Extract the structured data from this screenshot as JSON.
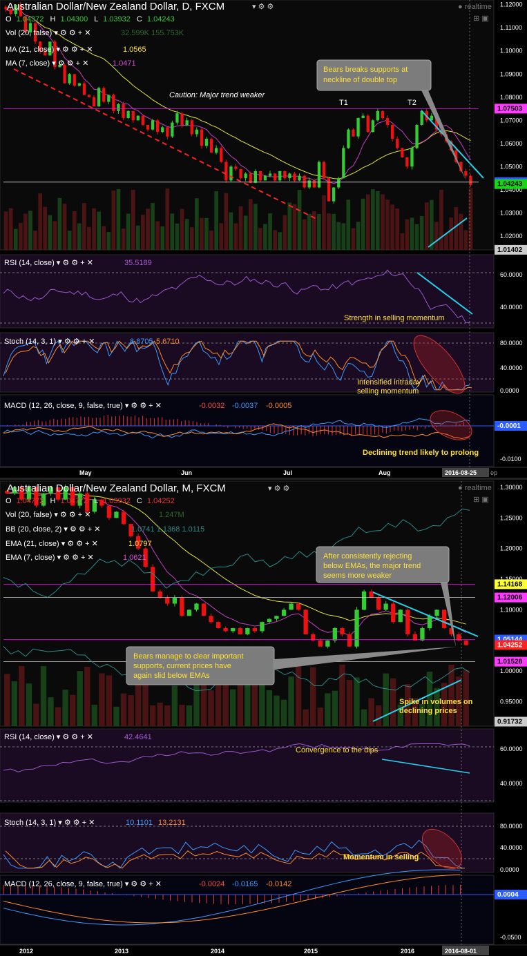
{
  "panel_daily": {
    "title": "Australian Dollar/New Zealand Dollar, D, FXCM",
    "realtime": "realtime",
    "ohlc": {
      "o_label": "O",
      "o": "1.04372",
      "h_label": "H",
      "h": "1.04300",
      "l_label": "L",
      "l": "1.03932",
      "c_label": "C",
      "c": "1.04243"
    },
    "vol_label": "Vol (20, false)",
    "vol_values": "32.599K 155.753K",
    "ma21_label": "MA (21, close)",
    "ma21_value": "1.0565",
    "ma7_label": "MA (7, close)",
    "ma7_value": "1.0471",
    "price_ticks": [
      "1.12000",
      "1.11000",
      "1.10000",
      "1.09000",
      "1.08000",
      "1.07000",
      "1.06000",
      "1.05000",
      "1.04000",
      "1.03000",
      "1.02000"
    ],
    "price_tags": [
      "1.07503",
      "1.04331",
      "1.04243",
      "1.01402"
    ],
    "annotations": {
      "caution": "Caution: Major trend weaker",
      "t1": "T1",
      "t2": "T2",
      "box": [
        "Bears breaks supports at",
        "neckline of double top"
      ]
    },
    "rsi_label": "RSI (14, close)",
    "rsi_value": "35.5189",
    "rsi_ticks": [
      "60.0000",
      "40.0000"
    ],
    "rsi_note": "Strength in selling momentum",
    "stoch_label": "Stoch (14, 3, 1)",
    "stoch_k": "8.8705",
    "stoch_d": "5.6710",
    "stoch_ticks": [
      "80.0000",
      "40.0000",
      "0.0000"
    ],
    "stoch_note": [
      "Intensified intraday",
      "selling momentum"
    ],
    "macd_label": "MACD (12, 26, close, 9, false, true)",
    "macd_v1": "-0.0032",
    "macd_v2": "-0.0037",
    "macd_v3": "-0.0005",
    "macd_ticks": [
      "-0.0001",
      "-0.0100"
    ],
    "macd_note": "Declining trend likely to prolong",
    "x_ticks": [
      "May",
      "Jun",
      "Jul",
      "Aug"
    ],
    "x_current": "2016-08-25",
    "x_tail": "ep"
  },
  "panel_monthly": {
    "title": "Australian Dollar/New Zealand Dollar, M, FXCM",
    "realtime": "realtime",
    "ohlc": {
      "o_label": "O",
      "o": "1.04772",
      "h_label": "H",
      "h": "1.04772",
      "l_label": "L",
      "l": "1.03932",
      "c_label": "C",
      "c": "1.04252"
    },
    "vol_label": "Vol (20, false)",
    "vol_values": "1.247M",
    "bb_label": "BB (20, close, 2)",
    "bb_values": "1.0741 1.1368 1.0115",
    "ema21_label": "EMA (21, close)",
    "ema21_value": "1.0797",
    "ema7_label": "EMA (7, close)",
    "ema7_value": "1.0621",
    "price_ticks": [
      "1.30000",
      "1.25000",
      "1.20000",
      "1.15000",
      "1.10000",
      "1.05000",
      "1.00000",
      "0.95000"
    ],
    "price_tags": [
      "1.14168",
      "1.12006",
      "1.05144",
      "1.04252",
      "1.01528",
      "0.91732"
    ],
    "annotations": {
      "box_top": [
        "After consistently rejecting",
        "below EMAs, the major trend",
        "seems more weaker"
      ],
      "box_bottom": [
        "Bears manage to clear important",
        "supports, current prices have",
        "again slid below EMAs"
      ],
      "volume_note": [
        "Spike in volumes on",
        "declining prices"
      ]
    },
    "rsi_label": "RSI (14, close)",
    "rsi_value": "42.4641",
    "rsi_ticks": [
      "60.0000",
      "40.0000"
    ],
    "rsi_note": "Convergence to the dips",
    "stoch_label": "Stoch (14, 3, 1)",
    "stoch_k": "10.1101",
    "stoch_d": "13.2131",
    "stoch_ticks": [
      "80.0000",
      "40.0000",
      "0.0000"
    ],
    "stoch_note": "Momentum in selling",
    "macd_label": "MACD (12, 26, close, 9, false, true)",
    "macd_v1": "-0.0024",
    "macd_v2": "-0.0165",
    "macd_v3": "-0.0142",
    "macd_ticks": [
      "0.0004",
      "-0.0500"
    ],
    "x_ticks": [
      "2012",
      "2013",
      "2014",
      "2015",
      "2016"
    ],
    "x_current": "2016-08-01"
  },
  "colors": {
    "up": "#33cc33",
    "down": "#ee1111",
    "accent": "#00bfff",
    "highlight": "#ff00ff",
    "note": "#ffe135",
    "arrow": "#22d3ee"
  },
  "chart_data": [
    {
      "type": "candlestick",
      "title": "Australian Dollar/New Zealand Dollar, D, FXCM",
      "timeframe": "Daily",
      "x_range": [
        "Apr 2016",
        "2016-08-25"
      ],
      "ylim": [
        1.014,
        1.122
      ],
      "closes": [
        1.118,
        1.116,
        1.12,
        1.115,
        1.108,
        1.112,
        1.104,
        1.1,
        1.098,
        1.104,
        1.093,
        1.094,
        1.086,
        1.09,
        1.085,
        1.086,
        1.081,
        1.08,
        1.076,
        1.084,
        1.078,
        1.081,
        1.074,
        1.077,
        1.071,
        1.074,
        1.07,
        1.072,
        1.068,
        1.066,
        1.07,
        1.065,
        1.067,
        1.063,
        1.069,
        1.073,
        1.068,
        1.07,
        1.064,
        1.066,
        1.059,
        1.062,
        1.056,
        1.058,
        1.052,
        1.044,
        1.05,
        1.049,
        1.045,
        1.047,
        1.043,
        1.048,
        1.044,
        1.046,
        1.047,
        1.044,
        1.048,
        1.045,
        1.047,
        1.044,
        1.046,
        1.041,
        1.044,
        1.041,
        1.052,
        1.045,
        1.035,
        1.041,
        1.045,
        1.058,
        1.066,
        1.063,
        1.071,
        1.072,
        1.065,
        1.07,
        1.074,
        1.071,
        1.068,
        1.062,
        1.058,
        1.054,
        1.05,
        1.058,
        1.068,
        1.074,
        1.07,
        1.072,
        1.066,
        1.064,
        1.061,
        1.057,
        1.052,
        1.048,
        1.046,
        1.042
      ],
      "ma21_last": 1.0565,
      "ma7_last": 1.0471,
      "horizontal_levels": [
        1.07503,
        1.04331
      ],
      "rsi_last": 35.5189,
      "stoch_k_last": 8.8705,
      "stoch_d_last": 5.671,
      "macd_last": [
        -0.0032,
        -0.0037,
        -0.0005
      ]
    },
    {
      "type": "candlestick",
      "title": "Australian Dollar/New Zealand Dollar, M, FXCM",
      "timeframe": "Monthly",
      "x_range": [
        "2011",
        "2016-08-01"
      ],
      "ylim": [
        0.91,
        1.31
      ],
      "closes": [
        1.29,
        1.3,
        1.28,
        1.3,
        1.27,
        1.29,
        1.3,
        1.28,
        1.3,
        1.27,
        1.29,
        1.26,
        1.28,
        1.27,
        1.25,
        1.26,
        1.24,
        1.22,
        1.2,
        1.17,
        1.13,
        1.12,
        1.11,
        1.12,
        1.09,
        1.1,
        1.11,
        1.09,
        1.08,
        1.07,
        1.065,
        1.07,
        1.06,
        1.07,
        1.065,
        1.08,
        1.085,
        1.09,
        1.1,
        1.11,
        1.1,
        1.06,
        1.05,
        1.04,
        1.05,
        1.07,
        1.06,
        1.04,
        1.1,
        1.13,
        1.12,
        1.1,
        1.11,
        1.08,
        1.1,
        1.06,
        1.05,
        1.07,
        1.09,
        1.1,
        1.07,
        1.06,
        1.05,
        1.0425
      ],
      "ema21_last": 1.0797,
      "ema7_last": 1.0621,
      "horizontal_levels": [
        1.14168,
        1.12006,
        1.05144,
        1.01528
      ],
      "rsi_last": 42.4641,
      "stoch_k_last": 10.1101,
      "stoch_d_last": 13.2131,
      "macd_last": [
        -0.0024,
        -0.0165,
        -0.0142
      ]
    }
  ]
}
